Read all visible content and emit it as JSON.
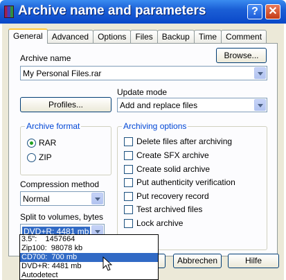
{
  "window": {
    "title": "Archive name and parameters",
    "help_glyph": "?",
    "close_glyph": "✕"
  },
  "tabs": [
    "General",
    "Advanced",
    "Options",
    "Files",
    "Backup",
    "Time",
    "Comment"
  ],
  "general": {
    "archive_name_label": "Archive name",
    "browse_label": "Browse...",
    "archive_name_value": "My Personal Files.rar",
    "update_mode_label": "Update mode",
    "profiles_label": "Profiles...",
    "update_mode_value": "Add and replace files",
    "archive_format": {
      "title": "Archive format",
      "options": [
        "RAR",
        "ZIP"
      ],
      "selected": "RAR"
    },
    "compression_label": "Compression method",
    "compression_value": "Normal",
    "split_label": "Split to volumes, bytes",
    "split_value": "DVD+R: 4481 mb",
    "archiving_options": {
      "title": "Archiving options",
      "items": [
        "Delete files after archiving",
        "Create SFX archive",
        "Create solid archive",
        "Put authenticity verification",
        "Put recovery record",
        "Test archived files",
        "Lock archive"
      ]
    }
  },
  "split_dropdown": {
    "options": [
      "3.5\":    1457664",
      "Zip100:  98078 kb",
      "CD700:  700 mb",
      "DVD+R: 4481 mb",
      "Autodetect"
    ],
    "highlighted_index": 2
  },
  "buttons": {
    "cancel": "Abbrechen",
    "help": "Hilfe"
  }
}
